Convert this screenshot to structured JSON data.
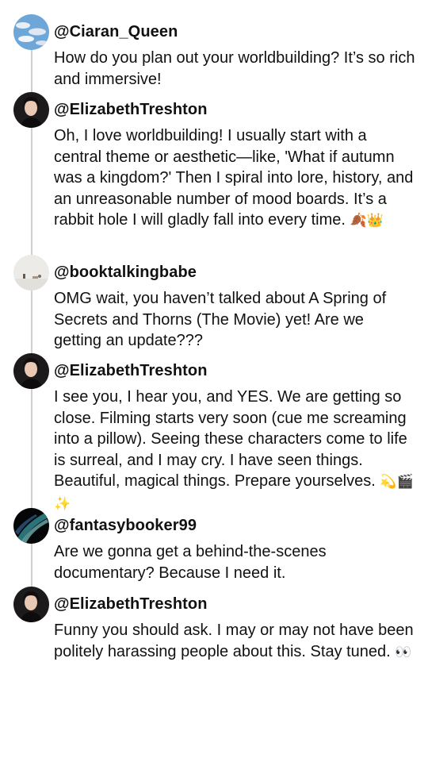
{
  "thread": {
    "posts": [
      {
        "handle": "@Ciaran_Queen",
        "avatar": "sky-clouds-avatar",
        "text": "How do you plan out your worldbuilding? It’s so rich and immersive!"
      },
      {
        "handle": "@ElizabethTreshton",
        "avatar": "author-portrait-avatar",
        "text": "Oh, I love worldbuilding! I usually start with a central theme or aesthetic—like, 'What if autumn was a kingdom?' Then I spiral into lore, history, and an unreasonable number of mood boards. It’s a rabbit hole I will gladly fall into every time.",
        "emoji": "🍂👑"
      },
      {
        "handle": "@booktalkingbabe",
        "avatar": "room-shelf-avatar",
        "text": "OMG wait, you haven’t talked about A Spring of Secrets and Thorns (The Movie) yet! Are we getting an update???"
      },
      {
        "handle": "@ElizabethTreshton",
        "avatar": "author-portrait-avatar",
        "text": "I see you, I hear you, and YES. We are getting so close. Filming starts very soon (cue me screaming into a pillow). Seeing these characters come to life is surreal, and I may cry. I have seen things. Beautiful, magical things. Prepare yourselves.",
        "emoji": "💫🎬✨"
      },
      {
        "handle": "@fantasybooker99",
        "avatar": "aurora-avatar",
        "text": "Are we gonna get a behind-the-scenes documentary? Because I need it."
      },
      {
        "handle": "@ElizabethTreshton",
        "avatar": "author-portrait-avatar",
        "text": "Funny you should ask. I may or may not have been politely harassing people about this. Stay tuned.",
        "emoji": "👀"
      }
    ]
  }
}
